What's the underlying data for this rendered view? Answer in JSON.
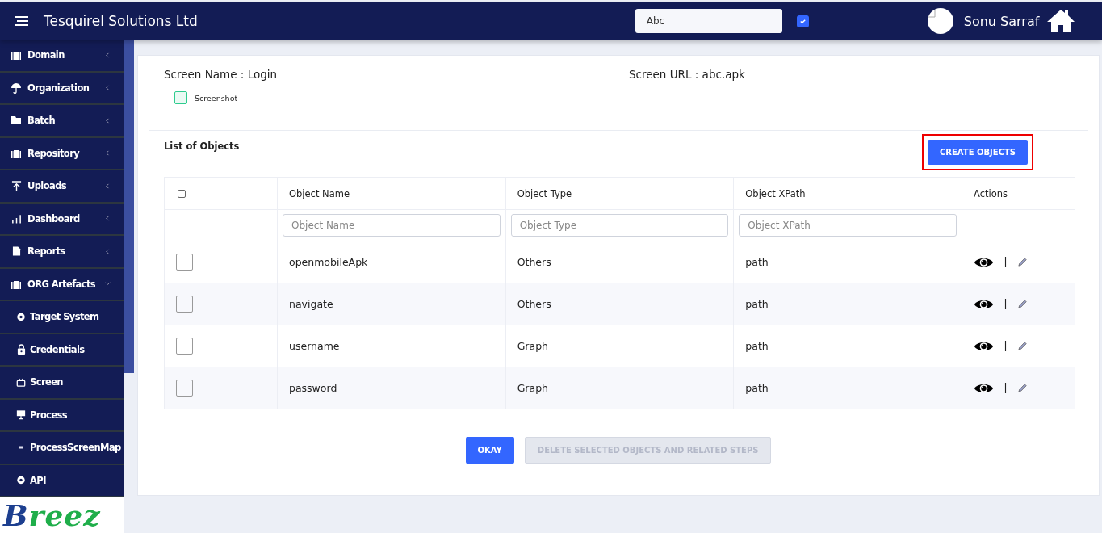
{
  "header": {
    "title": "Tesquirel Solutions Ltd",
    "search_value": "Abc",
    "checkbox_checked": true,
    "user_name": "Sonu Sarraf"
  },
  "sidebar": {
    "items": [
      {
        "label": "Domain",
        "kind": "suitcase",
        "expanded": false
      },
      {
        "label": "Organization",
        "kind": "umbrella",
        "expanded": false
      },
      {
        "label": "Batch",
        "kind": "folder",
        "expanded": false
      },
      {
        "label": "Repository",
        "kind": "suitcase",
        "expanded": false
      },
      {
        "label": "Uploads",
        "kind": "upload",
        "expanded": false
      },
      {
        "label": "Dashboard",
        "kind": "bars",
        "expanded": false
      },
      {
        "label": "Reports",
        "kind": "document",
        "expanded": false
      },
      {
        "label": "ORG Artefacts",
        "kind": "suitcase",
        "expanded": true,
        "children": [
          {
            "label": "Target System",
            "kind": "gear"
          },
          {
            "label": "Credentials",
            "kind": "lock"
          },
          {
            "label": "Screen",
            "kind": "tv"
          },
          {
            "label": "Process",
            "kind": "monitor"
          },
          {
            "label": "ProcessScreenMap",
            "kind": "dot"
          },
          {
            "label": "API",
            "kind": "gear"
          }
        ]
      }
    ]
  },
  "logo": "Breez",
  "screen": {
    "name": "Screen Name : Login",
    "url": "Screen URL : abc.apk",
    "screenshot": {
      "label": "Screenshot",
      "checked": false
    }
  },
  "list_title": "List of Objects",
  "create_button": "CREATE OBJECTS",
  "table": {
    "select_all_checked": false,
    "columns": [
      "Object Name",
      "Object Type",
      "Object XPath",
      "Actions"
    ],
    "filters": [
      {
        "placeholder": "Object Name"
      },
      {
        "placeholder": "Object Type"
      },
      {
        "placeholder": "Object XPath"
      }
    ],
    "rows": [
      {
        "checked": false,
        "name": "openmobileApk",
        "type": "Others",
        "xpath": "path"
      },
      {
        "checked": false,
        "name": "navigate",
        "type": "Others",
        "xpath": "path"
      },
      {
        "checked": false,
        "name": "username",
        "type": "Graph",
        "xpath": "path"
      },
      {
        "checked": false,
        "name": "password",
        "type": "Graph",
        "xpath": "path"
      }
    ]
  },
  "buttons": [
    {
      "label": "OKAY",
      "disabled": false
    },
    {
      "label": "DELETE SELECTED OBJECTS AND RELATED STEPS",
      "disabled": true
    }
  ]
}
